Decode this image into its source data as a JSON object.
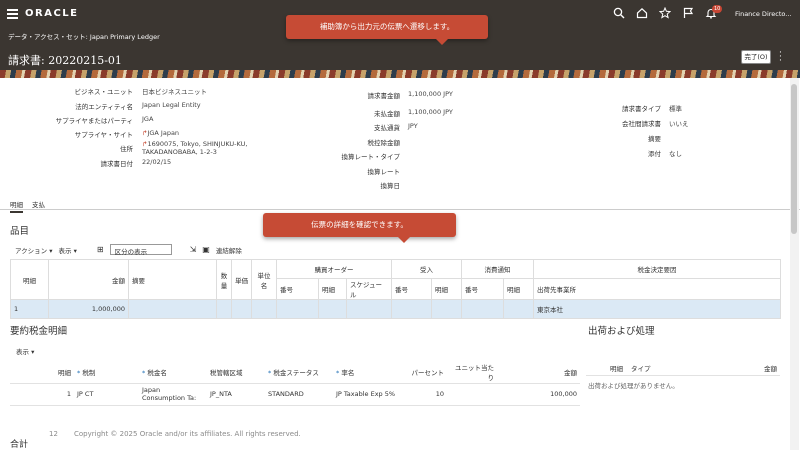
{
  "header": {
    "logo": "ORACLE",
    "context": "データ・アクセス・セット: Japan Primary Ledger",
    "page_title": "請求書: 20220215-01",
    "user": "Finance Directo...",
    "notification_count": "10",
    "done_label": "完了(O)"
  },
  "callouts": {
    "top": "補助簿から出力元の伝票へ遷移します。",
    "middle": "伝票の詳細を確認できます。"
  },
  "summary": {
    "col1": [
      {
        "label": "ビジネス・ユニット",
        "value": "日本ビジネスユニット"
      },
      {
        "label": "法的エンティティ名",
        "value": "Japan Legal Entity"
      },
      {
        "label": "サプライヤまたはパーティ",
        "value": "JGA"
      },
      {
        "label": "サプライヤ・サイト",
        "value": "JGA Japan"
      },
      {
        "label": "住所",
        "value": "1690075, Tokyo, SHINJUKU-KU, TAKADANOBABA, 1-2-3"
      },
      {
        "label": "請求書日付",
        "value": "22/02/15"
      }
    ],
    "col2": [
      {
        "label": "請求書金額",
        "value": "1,100,000 JPY"
      },
      {
        "label": "未払金額",
        "value": "1,100,000 JPY"
      },
      {
        "label": "支払通貨",
        "value": "JPY"
      },
      {
        "label": "税控除金額",
        "value": ""
      },
      {
        "label": "換算レート・タイプ",
        "value": ""
      },
      {
        "label": "換算レート",
        "value": ""
      },
      {
        "label": "換算日",
        "value": ""
      }
    ],
    "col3": [
      {
        "label": "請求書タイプ",
        "value": "標準"
      },
      {
        "label": "会社間請求書",
        "value": "いいえ"
      },
      {
        "label": "摘要",
        "value": ""
      },
      {
        "label": "添付",
        "value": "なし"
      }
    ]
  },
  "tabs": [
    "明細",
    "支払"
  ],
  "lines": {
    "title": "品目",
    "actions_label": "アクション",
    "view_label": "表示",
    "filter_value": "区分の表示",
    "detach_label": "連結解除",
    "group_headers": {
      "po": "購買オーダー",
      "receipt": "受入",
      "consumption": "消費通知",
      "tax": "税金決定要因"
    },
    "columns": {
      "line": "明細",
      "amount": "金額",
      "description": "摘要",
      "quantity": "数量",
      "unit_price": "単価",
      "uom": "単位名",
      "po_number": "番号",
      "po_line": "明細",
      "po_schedule": "スケジュール",
      "receipt_number": "番号",
      "receipt_line": "明細",
      "cons_number": "番号",
      "cons_line": "明細",
      "ship_to": "出荷先事業所"
    },
    "rows": [
      {
        "line": "1",
        "amount": "1,000,000",
        "ship_to": "東京本社"
      }
    ]
  },
  "tax_summary": {
    "title": "要約税金明細",
    "view_label": "表示",
    "columns": {
      "line": "明細",
      "regime": "税制",
      "tax_name": "税金名",
      "jurisdiction": "税管轄区域",
      "status": "税金ステータス",
      "rate_name": "率名",
      "percent": "パーセント",
      "per_unit": "ユニット当たり",
      "amount": "金額"
    },
    "rows": [
      {
        "line": "1",
        "regime": "JP CT",
        "tax_name": "Japan Consumption Ta:",
        "jurisdiction": "JP_NTA",
        "status": "STANDARD",
        "rate_name": "JP Taxable Exp 5%",
        "percent": "10",
        "amount": "100,000"
      }
    ]
  },
  "shipping": {
    "title": "出荷および処理",
    "columns": {
      "line": "明細",
      "type": "タイプ",
      "amount": "金額"
    },
    "empty_text": "出荷および処理がありません。"
  },
  "totals_label": "合計",
  "footer": {
    "page_number": "12",
    "copyright": "Copyright © 2025 Oracle and/or its affiliates. All rights reserved."
  }
}
